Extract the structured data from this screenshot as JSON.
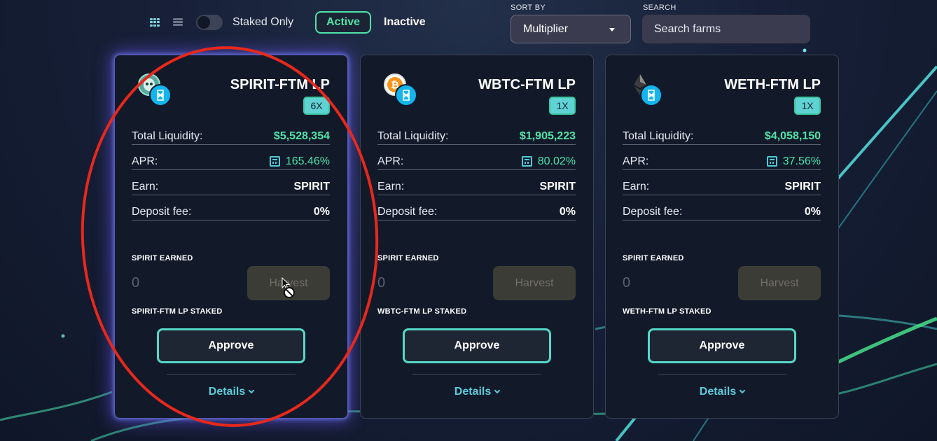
{
  "toolbar": {
    "staked_only_label": "Staked Only",
    "staked_only_on": false,
    "active_label": "Active",
    "inactive_label": "Inactive",
    "sort_by_label": "SORT BY",
    "sort_value": "Multiplier",
    "search_label": "SEARCH",
    "search_placeholder": "Search farms",
    "view_icons": [
      "grid-view-icon",
      "list-view-icon"
    ]
  },
  "cards": [
    {
      "title": "SPIRIT-FTM LP",
      "multiplier": "6X",
      "token_icons": [
        "spirit-token-icon",
        "fantom-token-icon"
      ],
      "total_liquidity_label": "Total Liquidity:",
      "total_liquidity": "$5,528,354",
      "apr_label": "APR:",
      "apr": "165.46%",
      "earn_label": "Earn:",
      "earn": "SPIRIT",
      "deposit_fee_label": "Deposit fee:",
      "deposit_fee": "0%",
      "earned_label": "SPIRIT EARNED",
      "earned_amount": "0",
      "harvest_label": "Harvest",
      "staked_label": "SPIRIT-FTM LP STAKED",
      "approve_label": "Approve",
      "details_label": "Details"
    },
    {
      "title": "WBTC-FTM LP",
      "multiplier": "1X",
      "token_icons": [
        "bitcoin-token-icon",
        "fantom-token-icon"
      ],
      "total_liquidity_label": "Total Liquidity:",
      "total_liquidity": "$1,905,223",
      "apr_label": "APR:",
      "apr": "80.02%",
      "earn_label": "Earn:",
      "earn": "SPIRIT",
      "deposit_fee_label": "Deposit fee:",
      "deposit_fee": "0%",
      "earned_label": "SPIRIT EARNED",
      "earned_amount": "0",
      "harvest_label": "Harvest",
      "staked_label": "WBTC-FTM LP STAKED",
      "approve_label": "Approve",
      "details_label": "Details"
    },
    {
      "title": "WETH-FTM LP",
      "multiplier": "1X",
      "token_icons": [
        "ethereum-token-icon",
        "fantom-token-icon"
      ],
      "total_liquidity_label": "Total Liquidity:",
      "total_liquidity": "$4,058,150",
      "apr_label": "APR:",
      "apr": "37.56%",
      "earn_label": "Earn:",
      "earn": "SPIRIT",
      "deposit_fee_label": "Deposit fee:",
      "deposit_fee": "0%",
      "earned_label": "SPIRIT EARNED",
      "earned_amount": "0",
      "harvest_label": "Harvest",
      "staked_label": "WETH-FTM LP STAKED",
      "approve_label": "Approve",
      "details_label": "Details"
    }
  ],
  "colors": {
    "accent_green": "#4ee3a8",
    "accent_teal": "#5ecad8",
    "annotation_red": "#e8281c"
  }
}
